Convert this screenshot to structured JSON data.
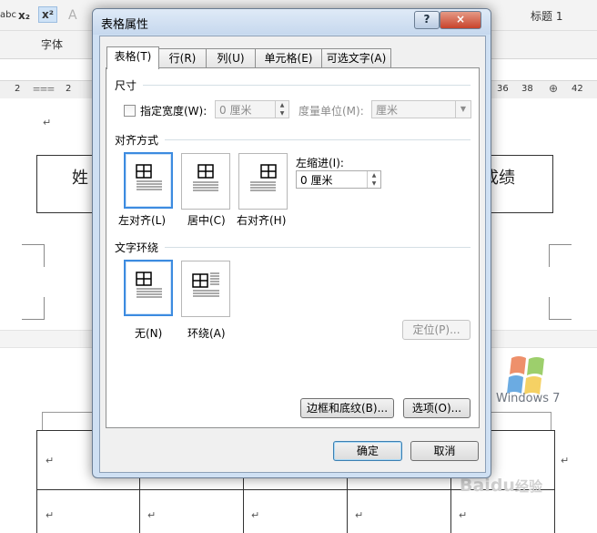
{
  "background": {
    "ribbon": {
      "font_group_label": "字体",
      "heading_style": "标题 1",
      "strike_glyph": "abc",
      "subscript_glyph": "x₂",
      "superscript_glyph": "x²"
    },
    "ruler": {
      "left_numbers": [
        "2",
        "2"
      ],
      "right_numbers": [
        "36",
        "38",
        "42"
      ]
    },
    "doc": {
      "cell_left_text": "姓",
      "cell_right_text": "成绩",
      "paragraph_mark": "↵"
    },
    "watermark": {
      "windows_text": "Windows 7",
      "baidu_text": "Baidu",
      "baidu_suffix": "经验"
    }
  },
  "dialog": {
    "title": "表格属性",
    "help_label": "?",
    "close_label": "×",
    "tabs": [
      {
        "label": "表格(T)",
        "active": true
      },
      {
        "label": "行(R)",
        "active": false
      },
      {
        "label": "列(U)",
        "active": false
      },
      {
        "label": "单元格(E)",
        "active": false
      },
      {
        "label": "可选文字(A)",
        "active": false
      }
    ],
    "size": {
      "section": "尺寸",
      "width_checkbox": "指定宽度(W):",
      "width_value": "0 厘米",
      "unit_label": "度量单位(M):",
      "unit_value": "厘米"
    },
    "alignment": {
      "section": "对齐方式",
      "options": [
        "左对齐(L)",
        "居中(C)",
        "右对齐(H)"
      ],
      "selected": "左对齐(L)",
      "indent_label": "左缩进(I):",
      "indent_value": "0 厘米"
    },
    "wrapping": {
      "section": "文字环绕",
      "options": [
        "无(N)",
        "环绕(A)"
      ],
      "selected": "无(N)",
      "position_button": "定位(P)..."
    },
    "borders_button": "边框和底纹(B)...",
    "options_button": "选项(O)...",
    "ok_button": "确定",
    "cancel_button": "取消"
  },
  "colors": {
    "dialog_frame": "#cfe0f3",
    "selected_border": "#3c8be0",
    "close_button": "#c8432b"
  }
}
